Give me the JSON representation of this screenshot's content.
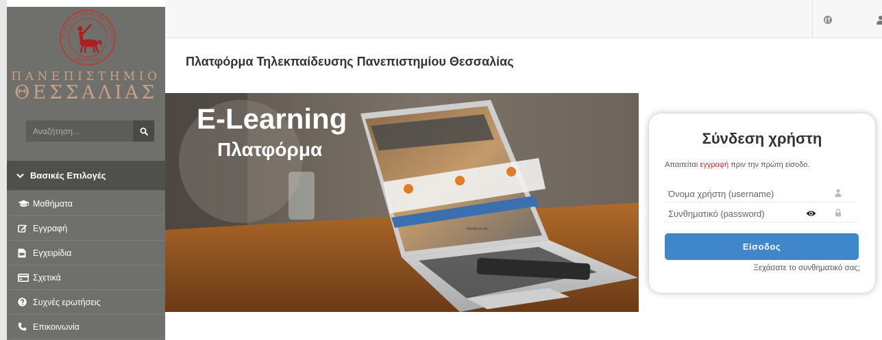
{
  "sidebar": {
    "logo": {
      "line1": "ΠΑΝΕΠΙΣΤΗΜΙΟ",
      "line2": "ΘΕΣΣΑΛΙΑΣ",
      "seal_text": "ΠΑΝΕΠΙΣΤΗΜΙΟ ΘΕΣΣΑΛΙΑΣ",
      "seal_year": "ΙΔΡΥΘΗΚΕ 1984"
    },
    "search": {
      "placeholder": "Αναζήτηση...",
      "icon": "search-icon"
    },
    "menu_header": {
      "label": "Βασικές Επιλογές",
      "icon": "chevron-down-icon"
    },
    "items": [
      {
        "label": "Μαθήματα",
        "icon": "graduation-cap-icon"
      },
      {
        "label": "Εγγραφή",
        "icon": "edit-icon"
      },
      {
        "label": "Εγχειρίδια",
        "icon": "file-video-icon"
      },
      {
        "label": "Σχετικά",
        "icon": "credit-card-icon"
      },
      {
        "label": "Συχνές ερωτήσεις",
        "icon": "question-circle-icon"
      },
      {
        "label": "Επικοινωνία",
        "icon": "phone-icon"
      }
    ]
  },
  "topbar": {
    "language_icon": "globe-icon",
    "user_icon": "user-icon"
  },
  "main": {
    "title": "Πλατφόρμα Τηλεκπαίδευσης Πανεπιστημίου Θεσσαλίας",
    "banner": {
      "line1": "E-Learning",
      "line2": "Πλατφόρμα",
      "laptop_label": "MacBook Air"
    }
  },
  "login": {
    "title": "Σύνδεση χρήστη",
    "notice_before": "Απαιτείται ",
    "notice_link": "εγγραφή",
    "notice_after": " πριν την πρώτη είσοδο.",
    "username_placeholder": "Όνομα χρήστη (username)",
    "password_placeholder": "Συνθηματικό (password)",
    "submit_label": "Είσοδος",
    "forgot_label": "Ξεχάσατε το συνθηματικό σας;",
    "colors": {
      "button": "#3f87c9",
      "link": "#c9302c"
    }
  }
}
